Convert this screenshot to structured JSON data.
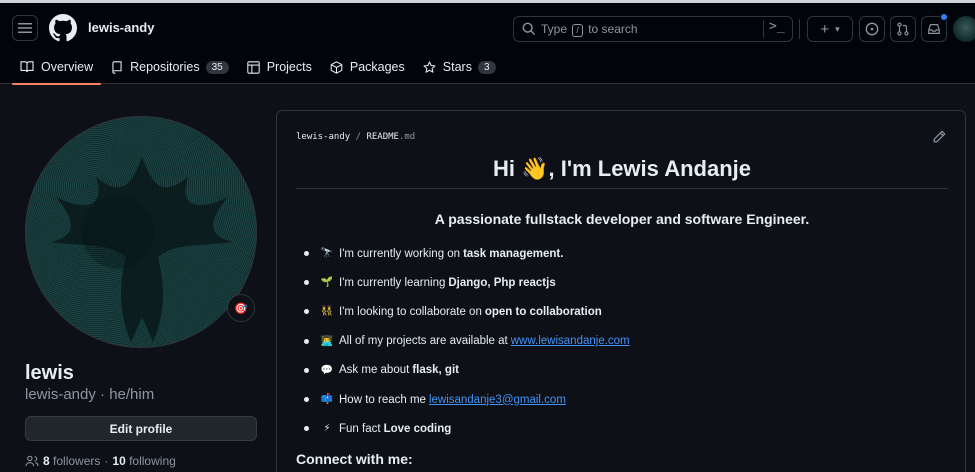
{
  "header": {
    "username": "lewis-andy",
    "search": {
      "prefix": "Type",
      "key": "/",
      "suffix": "to search"
    },
    "plus_caret": "▾"
  },
  "tabs": [
    {
      "label": "Overview",
      "count": null
    },
    {
      "label": "Repositories",
      "count": "35"
    },
    {
      "label": "Projects",
      "count": null
    },
    {
      "label": "Packages",
      "count": null
    },
    {
      "label": "Stars",
      "count": "3"
    }
  ],
  "profile": {
    "status_emoji": "🎯",
    "name": "lewis",
    "handle": "lewis-andy · he/him",
    "edit_button": "Edit profile",
    "followers_count": "8",
    "followers_label": "followers",
    "separator": "·",
    "following_count": "10",
    "following_label": "following"
  },
  "readme": {
    "crumb_user": "lewis-andy",
    "crumb_sep": "/",
    "crumb_file": "README",
    "crumb_ext": ".md",
    "heading": "Hi 👋, I'm Lewis Andanje",
    "subheading": "A passionate fullstack developer and software Engineer.",
    "items": [
      {
        "emoji": "🔭",
        "text": "I'm currently working on",
        "strong": "task management."
      },
      {
        "emoji": "🌱",
        "text": "I'm currently learning",
        "strong": "Django, Php reactjs"
      },
      {
        "emoji": "👯",
        "text": "I'm looking to collaborate on",
        "strong": "open to collaboration"
      },
      {
        "emoji": "👨‍💻",
        "text": "All of my projects are available at",
        "link": "www.lewisandanje.com"
      },
      {
        "emoji": "💬",
        "text": "Ask me about",
        "strong": "flask, git"
      },
      {
        "emoji": "📫",
        "text": "How to reach me",
        "link": "lewisandanje3@gmail.com"
      },
      {
        "emoji": "⚡",
        "text": "Fun fact",
        "strong": "Love coding"
      }
    ],
    "connect_heading": "Connect with me:"
  },
  "colors": {
    "accent": "#f78166",
    "link": "#4493f8",
    "background": "#0d1117"
  }
}
